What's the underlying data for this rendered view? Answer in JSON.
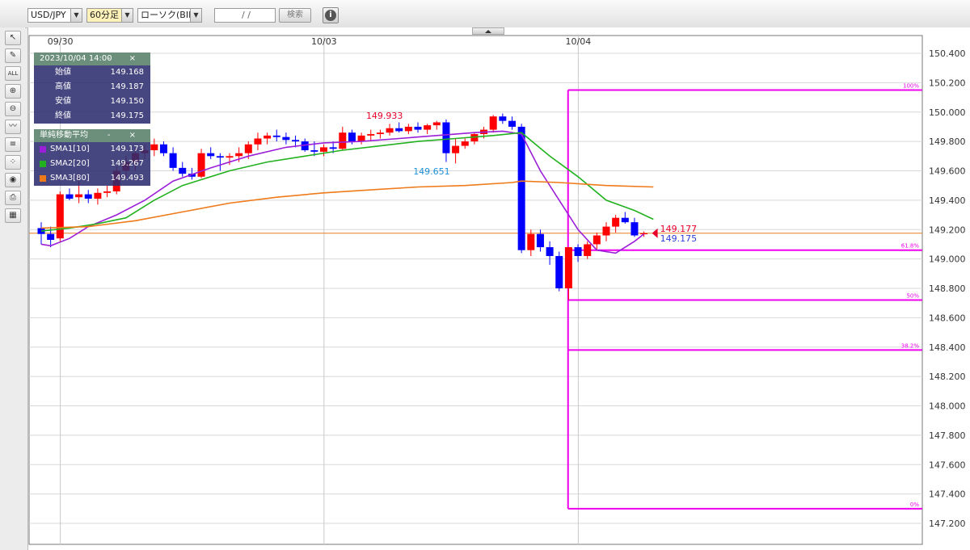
{
  "toolbar": {
    "symbol": "USD/JPY",
    "timeframe": "60分足",
    "chart_kind": "ローソク(BID)",
    "date_input": " /  / ",
    "search_label": "検索",
    "info_icon": "info-icon"
  },
  "sidebar": {
    "tools": [
      {
        "name": "cursor-icon",
        "glyph": "↖"
      },
      {
        "name": "pen-icon",
        "glyph": "✎"
      },
      {
        "name": "eraser-all-icon",
        "glyph": "ALL"
      },
      {
        "name": "zoom-in-icon",
        "glyph": "⊕"
      },
      {
        "name": "zoom-out-icon",
        "glyph": "⊖"
      },
      {
        "name": "indicator-icon",
        "glyph": "〰"
      },
      {
        "name": "price-list-icon",
        "glyph": "≡"
      },
      {
        "name": "candle-style-icon",
        "glyph": "⁘"
      },
      {
        "name": "eye-icon",
        "glyph": "◉"
      },
      {
        "name": "print-icon",
        "glyph": "⎙"
      },
      {
        "name": "grid-icon",
        "glyph": "▦"
      }
    ]
  },
  "ohlc_panel": {
    "datetime": "2023/10/04 14:00",
    "controls": "- ×",
    "rows": [
      {
        "label": "始値",
        "value": "149.168"
      },
      {
        "label": "高値",
        "value": "149.187"
      },
      {
        "label": "安値",
        "value": "149.150"
      },
      {
        "label": "終値",
        "value": "149.175"
      }
    ]
  },
  "sma_panel": {
    "title": "単純移動平均",
    "controls": "- ×",
    "rows": [
      {
        "label": "SMA1[10]",
        "value": "149.173",
        "color": "#9b1fd8"
      },
      {
        "label": "SMA2[20]",
        "value": "149.267",
        "color": "#22b11f"
      },
      {
        "label": "SMA3[80]",
        "value": "149.493",
        "color": "#ef7a1a"
      }
    ]
  },
  "chart_data": {
    "type": "candlestick",
    "ylim": [
      147.2,
      150.4
    ],
    "y_ticks": [
      "150.400",
      "150.200",
      "150.000",
      "149.800",
      "149.600",
      "149.400",
      "149.200",
      "149.000",
      "148.800",
      "148.600",
      "148.400",
      "148.200",
      "148.000",
      "147.800",
      "147.600",
      "147.400",
      "147.200"
    ],
    "date_labels": [
      {
        "label": "09/30",
        "index": 1
      },
      {
        "label": "10/03",
        "index": 29
      },
      {
        "label": "10/04",
        "index": 56
      }
    ],
    "colors": {
      "up": "#ff0000",
      "down": "#0000ff",
      "fib": "#ee00ee",
      "current": "#e67e22",
      "grid": "#d8d8d8"
    },
    "candles": [
      [
        149.21,
        149.25,
        149.1,
        149.17
      ],
      [
        149.17,
        149.22,
        149.08,
        149.13
      ],
      [
        149.14,
        149.46,
        149.12,
        149.44
      ],
      [
        149.44,
        149.48,
        149.4,
        149.41
      ],
      [
        149.42,
        149.58,
        149.38,
        149.44
      ],
      [
        149.44,
        149.47,
        149.38,
        149.41
      ],
      [
        149.41,
        149.48,
        149.37,
        149.45
      ],
      [
        149.45,
        149.5,
        149.42,
        149.46
      ],
      [
        149.46,
        149.63,
        149.44,
        149.6
      ],
      [
        149.6,
        149.7,
        149.55,
        149.66
      ],
      [
        149.66,
        149.75,
        149.6,
        149.72
      ],
      [
        149.72,
        149.78,
        149.68,
        149.74
      ],
      [
        149.74,
        149.82,
        149.7,
        149.78
      ],
      [
        149.78,
        149.8,
        149.7,
        149.72
      ],
      [
        149.72,
        149.76,
        149.6,
        149.62
      ],
      [
        149.62,
        149.66,
        149.56,
        149.58
      ],
      [
        149.58,
        149.62,
        149.54,
        149.56
      ],
      [
        149.56,
        149.75,
        149.55,
        149.72
      ],
      [
        149.72,
        149.76,
        149.68,
        149.7
      ],
      [
        149.7,
        149.72,
        149.6,
        149.69
      ],
      [
        149.69,
        149.72,
        149.64,
        149.7
      ],
      [
        149.7,
        149.76,
        149.66,
        149.72
      ],
      [
        149.72,
        149.8,
        149.68,
        149.78
      ],
      [
        149.78,
        149.86,
        149.74,
        149.82
      ],
      [
        149.82,
        149.86,
        149.78,
        149.84
      ],
      [
        149.84,
        149.88,
        149.8,
        149.83
      ],
      [
        149.83,
        149.86,
        149.78,
        149.81
      ],
      [
        149.81,
        149.84,
        149.76,
        149.8
      ],
      [
        149.8,
        149.82,
        149.73,
        149.74
      ],
      [
        149.74,
        149.8,
        149.7,
        149.73
      ],
      [
        149.73,
        149.78,
        149.7,
        149.76
      ],
      [
        149.76,
        149.8,
        149.72,
        149.75
      ],
      [
        149.75,
        149.9,
        149.74,
        149.86
      ],
      [
        149.86,
        149.88,
        149.78,
        149.8
      ],
      [
        149.8,
        149.86,
        149.78,
        149.84
      ],
      [
        149.84,
        149.88,
        149.8,
        149.85
      ],
      [
        149.85,
        149.88,
        149.82,
        149.86
      ],
      [
        149.86,
        149.92,
        149.84,
        149.89
      ],
      [
        149.89,
        149.93,
        149.86,
        149.87
      ],
      [
        149.87,
        149.92,
        149.85,
        149.9
      ],
      [
        149.9,
        149.93,
        149.86,
        149.88
      ],
      [
        149.88,
        149.92,
        149.85,
        149.91
      ],
      [
        149.91,
        149.94,
        149.88,
        149.93
      ],
      [
        149.93,
        149.95,
        149.66,
        149.72
      ],
      [
        149.72,
        149.82,
        149.65,
        149.77
      ],
      [
        149.77,
        149.82,
        149.75,
        149.8
      ],
      [
        149.8,
        149.86,
        149.78,
        149.85
      ],
      [
        149.85,
        149.9,
        149.82,
        149.88
      ],
      [
        149.88,
        149.98,
        149.86,
        149.97
      ],
      [
        149.97,
        149.99,
        149.92,
        149.94
      ],
      [
        149.94,
        149.97,
        149.88,
        149.9
      ],
      [
        149.9,
        149.92,
        149.04,
        149.06
      ],
      [
        149.06,
        149.2,
        149.02,
        149.17
      ],
      [
        149.17,
        149.2,
        149.05,
        149.08
      ],
      [
        149.08,
        149.12,
        148.96,
        149.02
      ],
      [
        149.02,
        149.05,
        148.78,
        148.8
      ],
      [
        148.8,
        149.08,
        148.72,
        149.08
      ],
      [
        149.08,
        149.1,
        148.98,
        149.02
      ],
      [
        149.02,
        149.12,
        149.0,
        149.1
      ],
      [
        149.1,
        149.18,
        149.06,
        149.16
      ],
      [
        149.16,
        149.25,
        149.12,
        149.22
      ],
      [
        149.22,
        149.3,
        149.18,
        149.28
      ],
      [
        149.28,
        149.32,
        149.24,
        149.25
      ],
      [
        149.25,
        149.28,
        149.15,
        149.16
      ],
      [
        149.168,
        149.187,
        149.15,
        149.175
      ]
    ],
    "sma": [
      {
        "name": "SMA1[10]",
        "color": "#9b1fd8",
        "values": [
          [
            0,
            149.1
          ],
          [
            1,
            149.09
          ],
          [
            3,
            149.14
          ],
          [
            5,
            149.22
          ],
          [
            8,
            149.3
          ],
          [
            11,
            149.4
          ],
          [
            14,
            149.53
          ],
          [
            18,
            149.62
          ],
          [
            22,
            149.7
          ],
          [
            26,
            149.76
          ],
          [
            30,
            149.79
          ],
          [
            34,
            149.8
          ],
          [
            38,
            149.82
          ],
          [
            42,
            149.84
          ],
          [
            46,
            149.86
          ],
          [
            49,
            149.87
          ],
          [
            51,
            149.85
          ],
          [
            53,
            149.6
          ],
          [
            55,
            149.4
          ],
          [
            57,
            149.2
          ],
          [
            59,
            149.06
          ],
          [
            61,
            149.04
          ],
          [
            63,
            149.12
          ],
          [
            64,
            149.17
          ]
        ]
      },
      {
        "name": "SMA2[20]",
        "color": "#22b11f",
        "values": [
          [
            0,
            149.19
          ],
          [
            3,
            149.21
          ],
          [
            6,
            149.24
          ],
          [
            9,
            149.28
          ],
          [
            12,
            149.4
          ],
          [
            15,
            149.5
          ],
          [
            20,
            149.6
          ],
          [
            24,
            149.66
          ],
          [
            28,
            149.7
          ],
          [
            32,
            149.74
          ],
          [
            36,
            149.77
          ],
          [
            40,
            149.8
          ],
          [
            44,
            149.82
          ],
          [
            48,
            149.84
          ],
          [
            51,
            149.86
          ],
          [
            54,
            149.7
          ],
          [
            57,
            149.56
          ],
          [
            60,
            149.4
          ],
          [
            63,
            149.33
          ],
          [
            65,
            149.27
          ]
        ]
      },
      {
        "name": "SMA3[80]",
        "color": "#ef7a1a",
        "values": [
          [
            0,
            149.21
          ],
          [
            5,
            149.22
          ],
          [
            10,
            149.26
          ],
          [
            15,
            149.32
          ],
          [
            20,
            149.38
          ],
          [
            25,
            149.42
          ],
          [
            30,
            149.45
          ],
          [
            35,
            149.47
          ],
          [
            40,
            149.49
          ],
          [
            45,
            149.5
          ],
          [
            50,
            149.52
          ],
          [
            51,
            149.53
          ],
          [
            55,
            149.52
          ],
          [
            60,
            149.5
          ],
          [
            65,
            149.49
          ]
        ]
      }
    ],
    "annotations": [
      {
        "text": "149.933",
        "index": 38,
        "price": 149.933,
        "color": "#e8002a",
        "pos": "above"
      },
      {
        "text": "149.651",
        "index": 43,
        "price": 149.651,
        "color": "#1a8fd8",
        "pos": "below"
      }
    ],
    "fibonacci": [
      {
        "label": "100%",
        "price": 150.15
      },
      {
        "label": "61.8%",
        "price": 149.06
      },
      {
        "label": "50%",
        "price": 148.72
      },
      {
        "label": "38.2%",
        "price": 148.38
      },
      {
        "label": "0%",
        "price": 147.3
      }
    ],
    "current": {
      "price": 149.175,
      "label_red": "149.177",
      "label_blue": "149.175"
    }
  }
}
